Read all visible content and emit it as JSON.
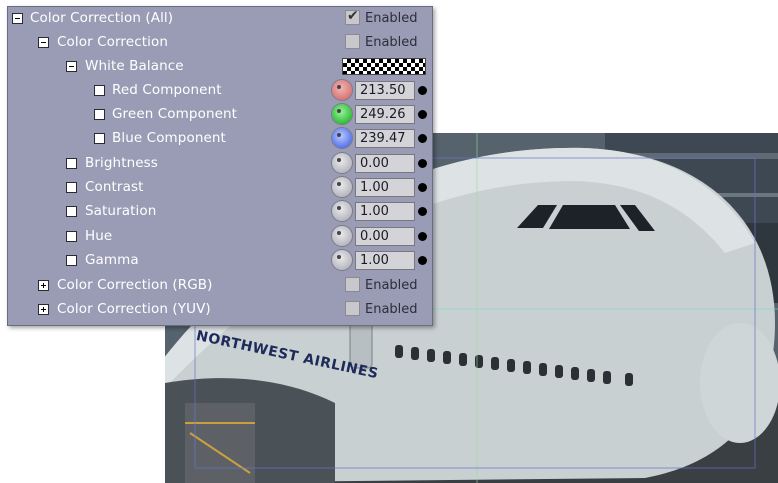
{
  "panel": {
    "rows": [
      {
        "label": "Color Correction (All)",
        "tree": "minus",
        "enabled_label": "Enabled",
        "checked": true
      },
      {
        "label": "Color Correction",
        "tree": "minus",
        "enabled_label": "Enabled",
        "checked": false
      },
      {
        "label": "White Balance",
        "tree": "minus"
      },
      {
        "label": "Red Component",
        "value": "213.50",
        "dial_color": "#d87878"
      },
      {
        "label": "Green Component",
        "value": "249.26",
        "dial_color": "#31c03a"
      },
      {
        "label": "Blue Component",
        "value": "239.47",
        "dial_color": "#5a78ea"
      },
      {
        "label": "Brightness",
        "value": "0.00"
      },
      {
        "label": "Contrast",
        "value": "1.00"
      },
      {
        "label": "Saturation",
        "value": "1.00"
      },
      {
        "label": "Hue",
        "value": "0.00"
      },
      {
        "label": "Gamma",
        "value": "1.00"
      },
      {
        "label": "Color Correction (RGB)",
        "tree": "plus",
        "enabled_label": "Enabled",
        "checked": false
      },
      {
        "label": "Color Correction (YUV)",
        "tree": "plus",
        "enabled_label": "Enabled",
        "checked": false
      }
    ]
  },
  "photo": {
    "airline_text": "NORTHWEST AIRLINES"
  },
  "colors": {
    "panel_bg": "#9a9cb6",
    "label_text": "#ffffff"
  }
}
